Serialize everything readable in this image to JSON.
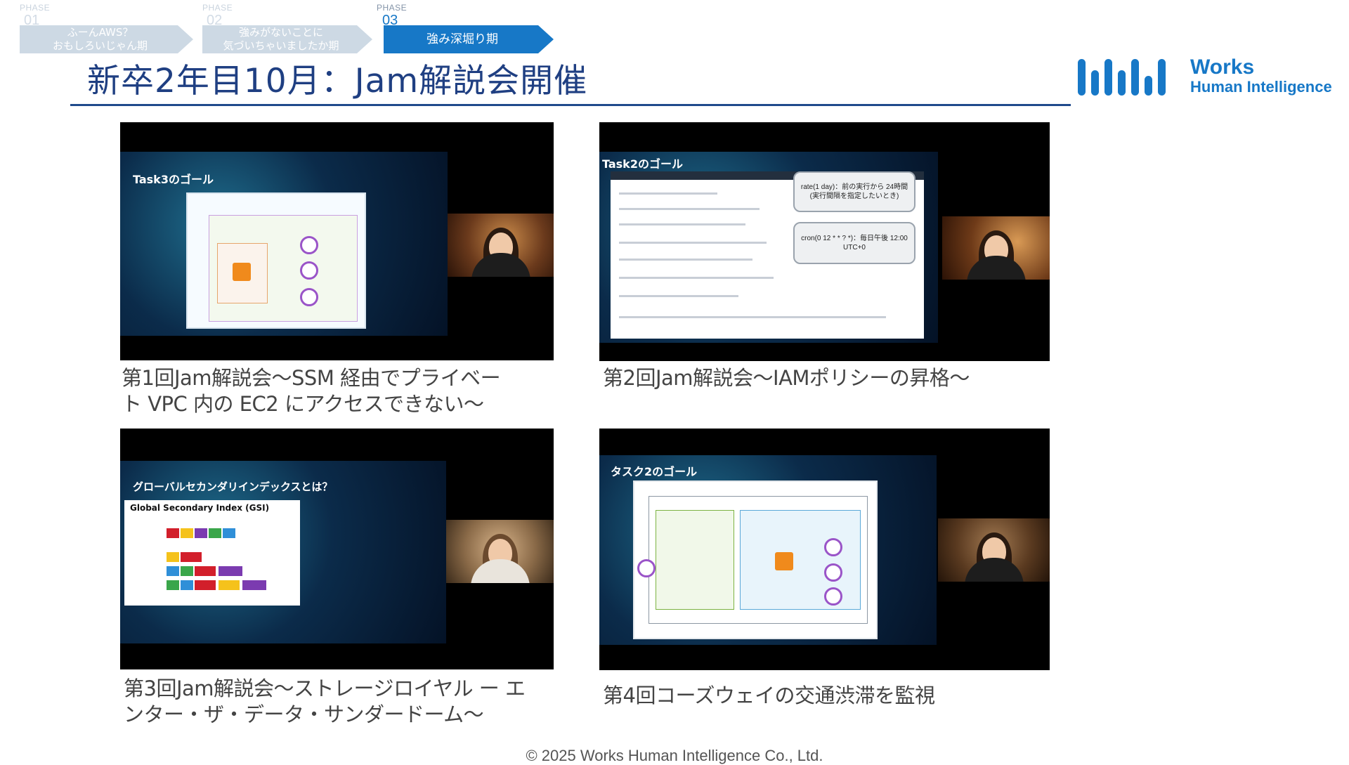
{
  "phases": [
    {
      "label": "PHASE",
      "number": "01",
      "text_line1": "ふーんAWS？",
      "text_line2": "おもしろいじゃん期",
      "state": "inactive"
    },
    {
      "label": "PHASE",
      "number": "02",
      "text_line1": "強みがないことに",
      "text_line2": "気づいちゃいましたか期",
      "state": "inactive"
    },
    {
      "label": "PHASE",
      "number": "03",
      "text_line1": "強み深堀り期",
      "text_line2": "",
      "state": "active"
    }
  ],
  "title": "新卒2年目10月：Jam解説会開催",
  "logo": {
    "line1": "Works",
    "line2": "Human Intelligence"
  },
  "sessions": [
    {
      "caption_line1": "第1回Jam解説会〜SSM 経由でプライベー",
      "caption_line2": "ト VPC 内の EC2 にアクセスできない〜",
      "slide_title": "Task3のゴール"
    },
    {
      "caption_line1": "第2回Jam解説会〜IAMポリシーの昇格〜",
      "caption_line2": "",
      "slide_title": "Task2のゴール",
      "callout1_line1": "rate(1 day)：前の実行から 24時間",
      "callout1_line2": "(実行間隔を指定したいとき)",
      "callout2_line1": "cron(0 12 * * ? *)：毎日午後 12:00",
      "callout2_line2": "UTC+0"
    },
    {
      "caption_line1": "第3回Jam解説会〜ストレージロイヤル ー エ",
      "caption_line2": "ンター・ザ・データ・サンダードーム〜",
      "slide_title": "グローバルセカンダリインデックスとは？",
      "panel_title": "Global Secondary Index (GSI)"
    },
    {
      "caption_line1": "第4回コーズウェイの交通渋滞を監視",
      "caption_line2": "",
      "slide_title": "タスク2のゴール"
    }
  ],
  "footer": "© 2025 Works Human Intelligence Co., Ltd."
}
